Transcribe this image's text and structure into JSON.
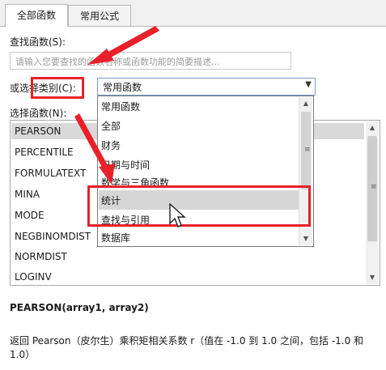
{
  "tabs": [
    {
      "label": "全部函数",
      "active": true
    },
    {
      "label": "常用公式",
      "active": false
    }
  ],
  "search": {
    "label": "查找函数(S):",
    "placeholder": "请输入您要查找的函数名称或函数功能的简要描述..."
  },
  "category": {
    "label": "或选择类别(C):",
    "selected": "常用函数",
    "options": [
      "常用函数",
      "全部",
      "财务",
      "日期与时间",
      "数学与三角函数",
      "统计",
      "查找与引用",
      "数据库"
    ],
    "highlighted": "统计"
  },
  "function_list": {
    "label": "选择函数(N):",
    "items": [
      "PEARSON",
      "PERCENTILE",
      "FORMULATEXT",
      "MINA",
      "MODE",
      "NEGBINOMDIST",
      "NORMDIST",
      "LOGINV"
    ],
    "selected": "PEARSON"
  },
  "signature": "PEARSON(array1, array2)",
  "description": "返回 Pearson（皮尔生）乘积矩相关系数 r（值在 -1.0 到 1.0 之间，包括 -1.0 和 1.0）",
  "colors": {
    "annotation_red": "#e8202a",
    "highlight_gray": "#d6d6d6",
    "combo_border": "#7a9cc6"
  }
}
